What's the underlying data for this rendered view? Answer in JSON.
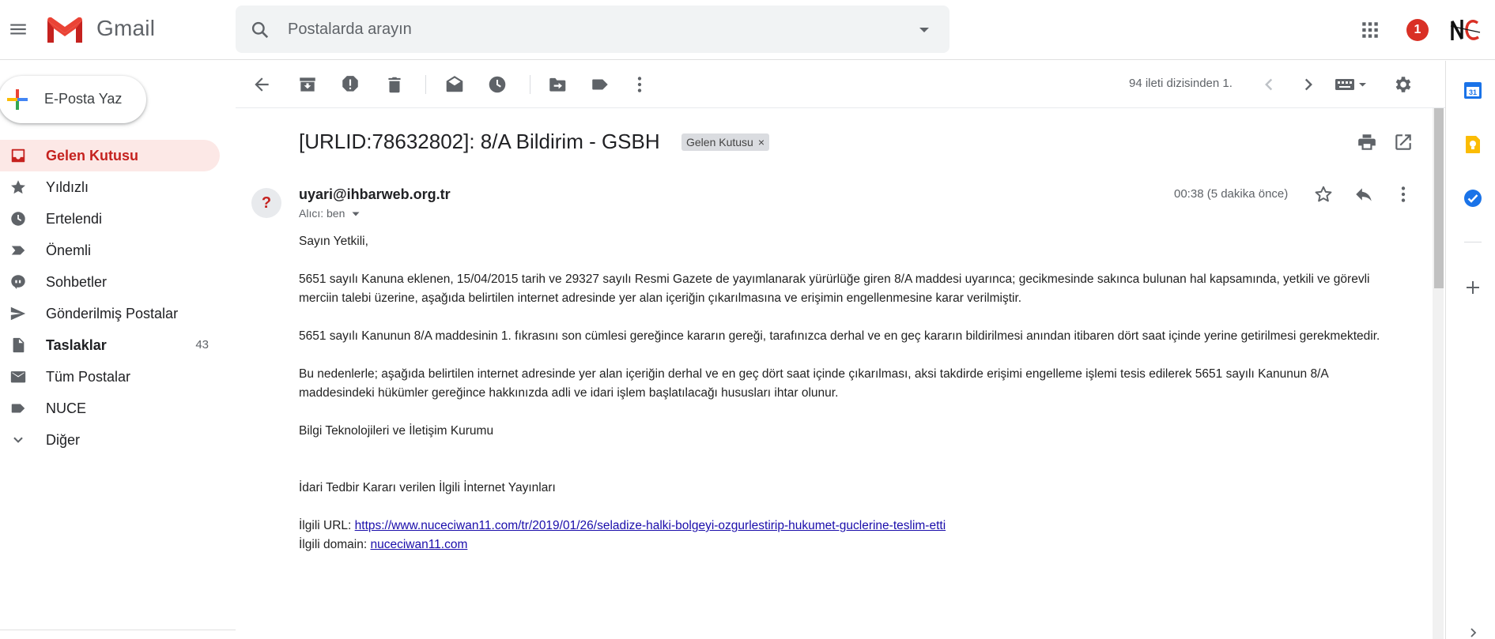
{
  "app": {
    "title": "Gmail",
    "notification_count": "1",
    "colors": {
      "gmail_red": "#ea4335",
      "active_bg": "#fce8e6",
      "active_text": "#c5221f",
      "link": "#1a0dab"
    }
  },
  "search": {
    "placeholder": "Postalarda arayın"
  },
  "compose": {
    "label": "E-Posta Yaz"
  },
  "sidebar": {
    "items": [
      {
        "label": "Gelen Kutusu",
        "icon": "inbox-icon",
        "active": true
      },
      {
        "label": "Yıldızlı",
        "icon": "star-icon"
      },
      {
        "label": "Ertelendi",
        "icon": "clock-icon"
      },
      {
        "label": "Önemli",
        "icon": "important-icon"
      },
      {
        "label": "Sohbetler",
        "icon": "chat-icon"
      },
      {
        "label": "Gönderilmiş Postalar",
        "icon": "send-icon"
      },
      {
        "label": "Taslaklar",
        "icon": "draft-icon",
        "count": "43",
        "bold": true
      },
      {
        "label": "Tüm Postalar",
        "icon": "mail-icon"
      },
      {
        "label": "NUCE",
        "icon": "label-icon"
      },
      {
        "label": "Diğer",
        "icon": "chevron-down-icon"
      }
    ]
  },
  "toolbar": {
    "pager": "94 ileti dizisinden 1."
  },
  "email": {
    "subject": "[URLID:78632802]: 8/A Bildirim - GSBH",
    "label_chip": "Gelen Kutusu",
    "label_chip_close": "×",
    "sender": "uyari@ihbarweb.org.tr",
    "recipient": "Alıcı: ben",
    "time": "00:38 (5 dakika önce)",
    "avatar": "?",
    "body": {
      "greeting": "Sayın Yetkili,",
      "p1": "5651 sayılı Kanuna eklenen, 15/04/2015 tarih ve 29327 sayılı Resmi Gazete de yayımlanarak yürürlüğe giren 8/A maddesi uyarınca; gecikmesinde sakınca bulunan hal kapsamında, yetkili ve görevli merciin talebi üzerine, aşağıda belirtilen internet adresinde yer alan içeriğin çıkarılmasına ve erişimin engellenmesine karar verilmiştir.",
      "p2": "5651 sayılı Kanunun 8/A maddesinin 1. fıkrasını son cümlesi gereğince kararın gereği, tarafınızca derhal ve en geç kararın bildirilmesi anından itibaren dört saat içinde yerine getirilmesi gerekmektedir.",
      "p3": "Bu nedenlerle;  aşağıda belirtilen internet adresinde yer alan içeriğin derhal ve en geç dört saat içinde çıkarılması, aksi takdirde erişimi engelleme işlemi tesis edilerek 5651 sayılı Kanunun 8/A maddesindeki hükümler gereğince hakkınızda adli ve idari işlem başlatılacağı hususları ihtar olunur.",
      "signature": "Bilgi Teknolojileri ve İletişim Kurumu",
      "section_title": "İdari Tedbir Kararı verilen İlgili İnternet Yayınları",
      "url_label": "İlgili URL: ",
      "url": "https://www.nuceciwan11.com/tr/2019/01/26/seladize-halki-bolgeyi-ozgurlestirip-hukumet-guclerine-teslim-etti",
      "domain_label": "İlgili domain: ",
      "domain": "nuceciwan11.com"
    }
  },
  "right_panel": {
    "calendar_day": "31"
  }
}
